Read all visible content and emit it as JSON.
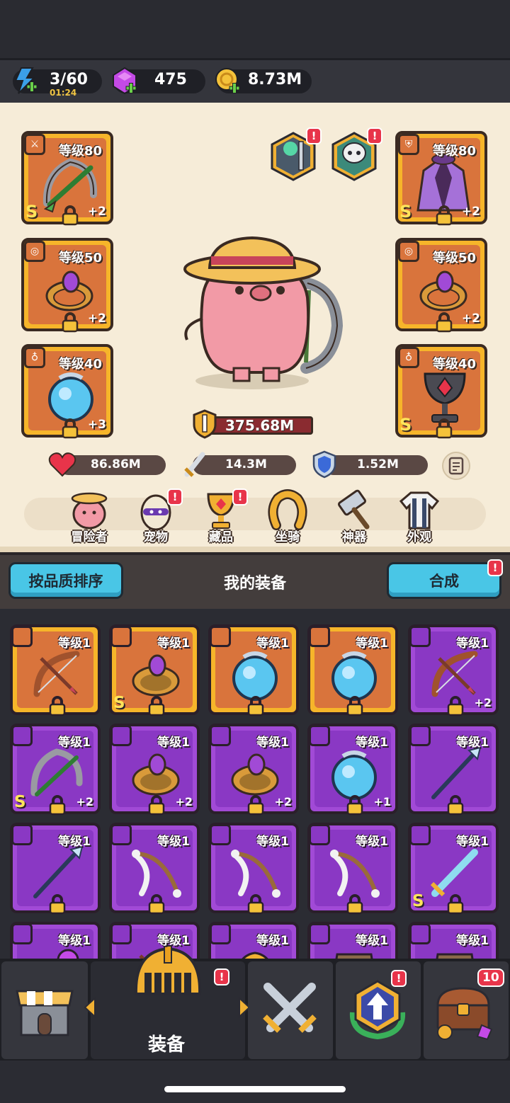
{
  "resources": {
    "energy": {
      "value": "3/60",
      "timer": "01:24",
      "icon": "lightning-plus-icon"
    },
    "gems": {
      "value": "475",
      "icon": "purple-gem-plus-icon"
    },
    "gold": {
      "value": "8.73M",
      "icon": "gold-coin-plus-icon"
    }
  },
  "hero": {
    "left_slots": [
      {
        "level": "等级80",
        "plus": "+2",
        "rank": "S",
        "icon": "crossbow-icon"
      },
      {
        "level": "等级50",
        "plus": "+2",
        "rank": "",
        "icon": "ring-icon"
      },
      {
        "level": "等级40",
        "plus": "+3",
        "rank": "",
        "icon": "orb-necklace-icon"
      }
    ],
    "right_slots": [
      {
        "level": "等级80",
        "plus": "+2",
        "rank": "S",
        "icon": "purple-cloak-icon"
      },
      {
        "level": "等级50",
        "plus": "+2",
        "rank": "",
        "icon": "ring-icon"
      },
      {
        "level": "等级40",
        "plus": "",
        "rank": "S",
        "icon": "chalice-icon"
      }
    ],
    "power": "375.68M",
    "stats": {
      "hp": "86.86M",
      "attack": "14.3M",
      "defense": "1.52M"
    },
    "badge": "!"
  },
  "categories": [
    {
      "label": "冒险者",
      "badge": ""
    },
    {
      "label": "宠物",
      "badge": "!"
    },
    {
      "label": "藏品",
      "badge": "!"
    },
    {
      "label": "坐骑",
      "badge": ""
    },
    {
      "label": "神器",
      "badge": ""
    },
    {
      "label": "外观",
      "badge": ""
    }
  ],
  "equipment": {
    "sort_button": "按品质排序",
    "title": "我的装备",
    "merge_button": "合成",
    "merge_badge": "!",
    "items": [
      {
        "level": "等级1",
        "plus": "",
        "rank": "",
        "quality": "gold",
        "icon": "bow-icon"
      },
      {
        "level": "等级1",
        "plus": "",
        "rank": "S",
        "quality": "gold",
        "icon": "ring-icon"
      },
      {
        "level": "等级1",
        "plus": "",
        "rank": "",
        "quality": "gold",
        "icon": "orb-necklace-icon"
      },
      {
        "level": "等级1",
        "plus": "",
        "rank": "",
        "quality": "gold",
        "icon": "orb-necklace-icon"
      },
      {
        "level": "等级1",
        "plus": "+2",
        "rank": "",
        "quality": "purple",
        "icon": "bow-icon"
      },
      {
        "level": "等级1",
        "plus": "+2",
        "rank": "S",
        "quality": "purple",
        "icon": "crossbow-icon"
      },
      {
        "level": "等级1",
        "plus": "+2",
        "rank": "",
        "quality": "purple",
        "icon": "ring-icon"
      },
      {
        "level": "等级1",
        "plus": "+2",
        "rank": "",
        "quality": "purple",
        "icon": "ring-icon"
      },
      {
        "level": "等级1",
        "plus": "+1",
        "rank": "",
        "quality": "purple",
        "icon": "orb-necklace-icon"
      },
      {
        "level": "等级1",
        "plus": "",
        "rank": "",
        "quality": "purple",
        "icon": "spear-icon"
      },
      {
        "level": "等级1",
        "plus": "",
        "rank": "",
        "quality": "purple",
        "icon": "spear-icon"
      },
      {
        "level": "等级1",
        "plus": "",
        "rank": "",
        "quality": "purple",
        "icon": "bone-bow-icon"
      },
      {
        "level": "等级1",
        "plus": "",
        "rank": "",
        "quality": "purple",
        "icon": "bone-bow-icon"
      },
      {
        "level": "等级1",
        "plus": "",
        "rank": "",
        "quality": "purple",
        "icon": "bone-bow-icon"
      },
      {
        "level": "等级1",
        "plus": "",
        "rank": "S",
        "quality": "purple",
        "icon": "sword-icon"
      },
      {
        "level": "等级1",
        "plus": "",
        "rank": "",
        "quality": "purple",
        "icon": "staff-icon"
      },
      {
        "level": "等级1",
        "plus": "",
        "rank": "",
        "quality": "purple",
        "icon": "bow-icon"
      },
      {
        "level": "等级1",
        "plus": "",
        "rank": "",
        "quality": "purple",
        "icon": "helmet-icon"
      },
      {
        "level": "等级1",
        "plus": "",
        "rank": "",
        "quality": "purple",
        "icon": "armor-icon"
      },
      {
        "level": "等级1",
        "plus": "",
        "rank": "",
        "quality": "purple",
        "icon": "armor-icon"
      }
    ]
  },
  "nav": {
    "active_label": "装备",
    "equip_badge": "!",
    "upgrade_badge": "!",
    "chest_count": "10"
  },
  "colors": {
    "gold_frame": "#f6b52a",
    "purple_frame": "#a14ad6",
    "accent_blue": "#49c6e6",
    "badge_red": "#e8344a"
  }
}
